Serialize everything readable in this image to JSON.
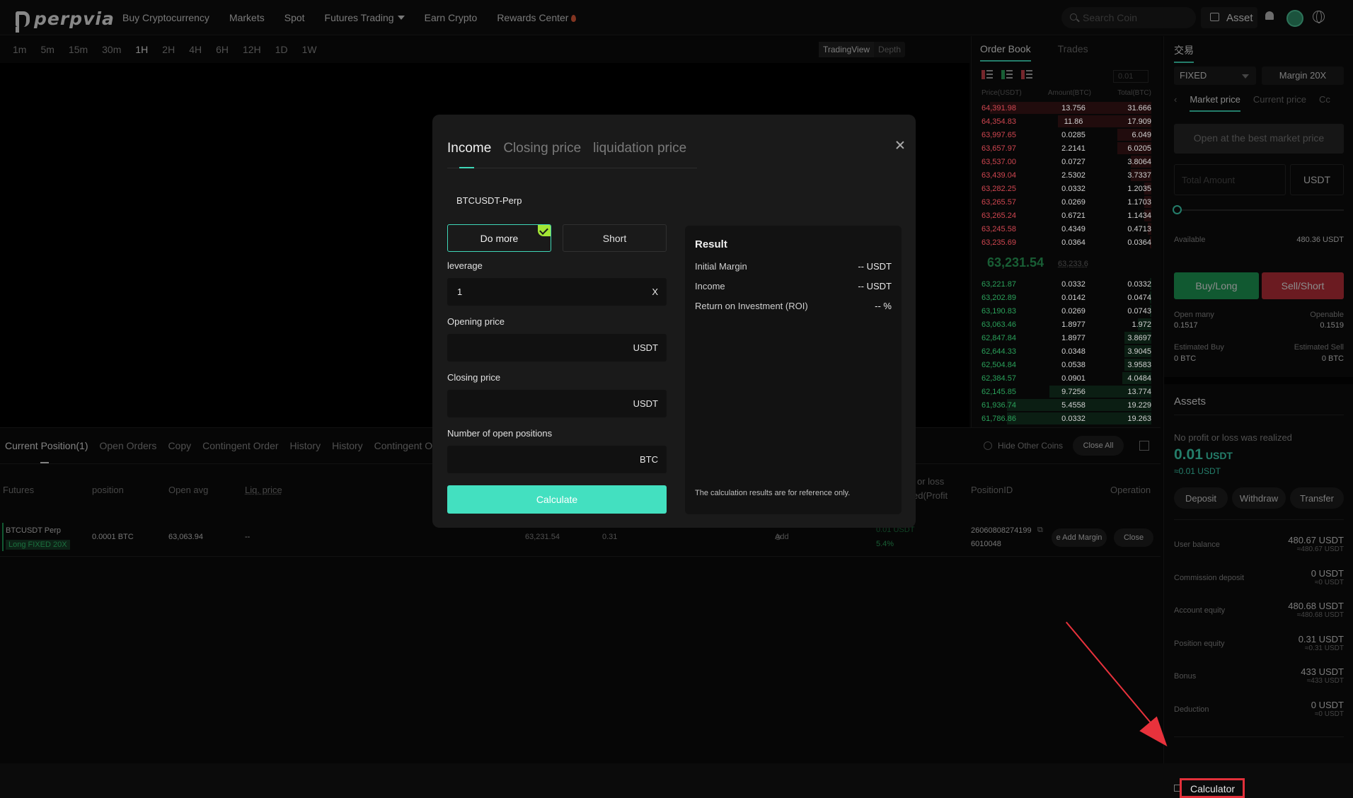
{
  "brand": {
    "name": "perpvia"
  },
  "nav": {
    "items": [
      "Buy Cryptocurrency",
      "Markets",
      "Spot",
      "Futures Trading",
      "Earn Crypto",
      "Rewards Center"
    ],
    "search_placeholder": "Search Coin",
    "asset_label": "Asset"
  },
  "timeframes": {
    "items": [
      "1m",
      "5m",
      "15m",
      "30m",
      "1H",
      "2H",
      "4H",
      "6H",
      "12H",
      "1D",
      "1W"
    ],
    "active": "1H",
    "view_tradingview": "TradingView",
    "view_depth": "Depth"
  },
  "orderbook": {
    "tab_book": "Order Book",
    "tab_trades": "Trades",
    "precision": "0.01",
    "col_price": "Price(USDT)",
    "col_amount": "Amount(BTC)",
    "col_total": "Total(BTC)",
    "asks": [
      [
        "64,391.98",
        "13.756",
        "31.666",
        0.95
      ],
      [
        "64,354.83",
        "11.86",
        "17.909",
        0.55
      ],
      [
        "63,997.65",
        "0.0285",
        "6.049",
        0.2
      ],
      [
        "63,657.97",
        "2.2141",
        "6.0205",
        0.2
      ],
      [
        "63,537.00",
        "0.0727",
        "3.8064",
        0.12
      ],
      [
        "63,439.04",
        "2.5302",
        "3.7337",
        0.12
      ],
      [
        "63,282.25",
        "0.0332",
        "1.2035",
        0.04
      ],
      [
        "63,265.57",
        "0.0269",
        "1.1703",
        0.04
      ],
      [
        "63,265.24",
        "0.6721",
        "1.1434",
        0.04
      ],
      [
        "63,245.58",
        "0.4349",
        "0.4713",
        0.02
      ],
      [
        "63,235.69",
        "0.0364",
        "0.0364",
        0.01
      ]
    ],
    "mid_price": "63,231.54",
    "mark_price": "63,233.6",
    "bids": [
      [
        "63,221.87",
        "0.0332",
        "0.0332",
        0.01
      ],
      [
        "63,202.89",
        "0.0142",
        "0.0474",
        0.01
      ],
      [
        "63,190.83",
        "0.0269",
        "0.0743",
        0.01
      ],
      [
        "63,063.46",
        "1.8977",
        "1.972",
        0.08
      ],
      [
        "62,847.84",
        "1.8977",
        "3.8697",
        0.16
      ],
      [
        "62,644.33",
        "0.0348",
        "3.9045",
        0.16
      ],
      [
        "62,504.84",
        "0.0538",
        "3.9583",
        0.16
      ],
      [
        "62,384.57",
        "0.0901",
        "4.0484",
        0.17
      ],
      [
        "62,145.85",
        "9.7256",
        "13.774",
        0.6
      ],
      [
        "61,936.74",
        "5.4558",
        "19.229",
        0.85
      ],
      [
        "61,786.86",
        "0.0332",
        "19.263",
        0.85
      ]
    ]
  },
  "trade_panel": {
    "title": "交易",
    "mode": "FIXED",
    "margin": "Margin 20X",
    "order_tabs": [
      "Market price",
      "Current price",
      "Cc"
    ],
    "best_market_placeholder": "Open at the best market price",
    "total_amount_placeholder": "Total Amount",
    "amount_unit": "USDT",
    "available_label": "Available",
    "available_value": "480.36 USDT",
    "buy_label": "Buy/Long",
    "sell_label": "Sell/Short",
    "open_many_label": "Open many",
    "open_many_value": "0.1517",
    "openable_label": "Openable",
    "openable_value": "0.1519",
    "est_buy_label": "Estimated Buy",
    "est_buy_value": "0 BTC",
    "est_sell_label": "Estimated Sell",
    "est_sell_value": "0 BTC"
  },
  "assets": {
    "title": "Assets",
    "pnl_label": "No profit or loss was realized",
    "pnl_value": "0.01",
    "pnl_unit": "USDT",
    "pnl_sub": "≈0.01 USDT",
    "deposit": "Deposit",
    "withdraw": "Withdraw",
    "transfer": "Transfer",
    "rows": [
      {
        "label": "User balance",
        "value": "480.67 USDT",
        "sub": "≈480.67 USDT"
      },
      {
        "label": "Commission deposit",
        "value": "0 USDT",
        "sub": "≈0 USDT"
      },
      {
        "label": "Account equity",
        "value": "480.68 USDT",
        "sub": "≈480.68 USDT"
      },
      {
        "label": "Position equity",
        "value": "0.31 USDT",
        "sub": "≈0.31 USDT"
      },
      {
        "label": "Bonus",
        "value": "433 USDT",
        "sub": "≈433 USDT"
      },
      {
        "label": "Deduction",
        "value": "0 USDT",
        "sub": "≈0 USDT"
      }
    ],
    "calculator": "Calculator"
  },
  "positions": {
    "tabs": [
      "Current Position(1)",
      "Open Orders",
      "Copy",
      "Contingent Order",
      "History",
      "History",
      "Contingent O"
    ],
    "hide_other": "Hide Other Coins",
    "close_all": "Close All",
    "headers": {
      "futures": "Futures",
      "position": "position",
      "open_avg": "Open avg",
      "liq": "Liq. price",
      "pnl1": "or loss",
      "pnl2": "ed(Profit",
      "posid": "PositionID",
      "operation": "Operation"
    },
    "row": {
      "symbol": "BTCUSDT Perp",
      "tag": "Long FIXED 20X",
      "position": "0.0001 BTC",
      "open_avg": "63,063.94",
      "liq": "--",
      "mark": "63,231.54",
      "margin": "0.31",
      "add": "Add",
      "pnl1": "0.01 USDT",
      "pnl2": "5.4%",
      "id1": "26060808274199",
      "id2": "6010048",
      "add_margin": "e Add Margin",
      "close": "Close"
    }
  },
  "calculator_modal": {
    "tabs": [
      "Income",
      "Closing price",
      "liquidation price"
    ],
    "symbol": "BTCUSDT-Perp",
    "do_more": "Do more",
    "short": "Short",
    "leverage_label": "leverage",
    "leverage_value": "1",
    "leverage_unit": "X",
    "opening_label": "Opening price",
    "opening_unit": "USDT",
    "closing_label": "Closing price",
    "closing_unit": "USDT",
    "positions_label": "Number of open positions",
    "positions_unit": "BTC",
    "calculate": "Calculate",
    "result_title": "Result",
    "results": [
      {
        "label": "Initial Margin",
        "value": "-- USDT"
      },
      {
        "label": "Income",
        "value": "-- USDT"
      },
      {
        "label": "Return on Investment (ROI)",
        "value": "-- %"
      }
    ],
    "note": "The calculation results are for reference only."
  }
}
